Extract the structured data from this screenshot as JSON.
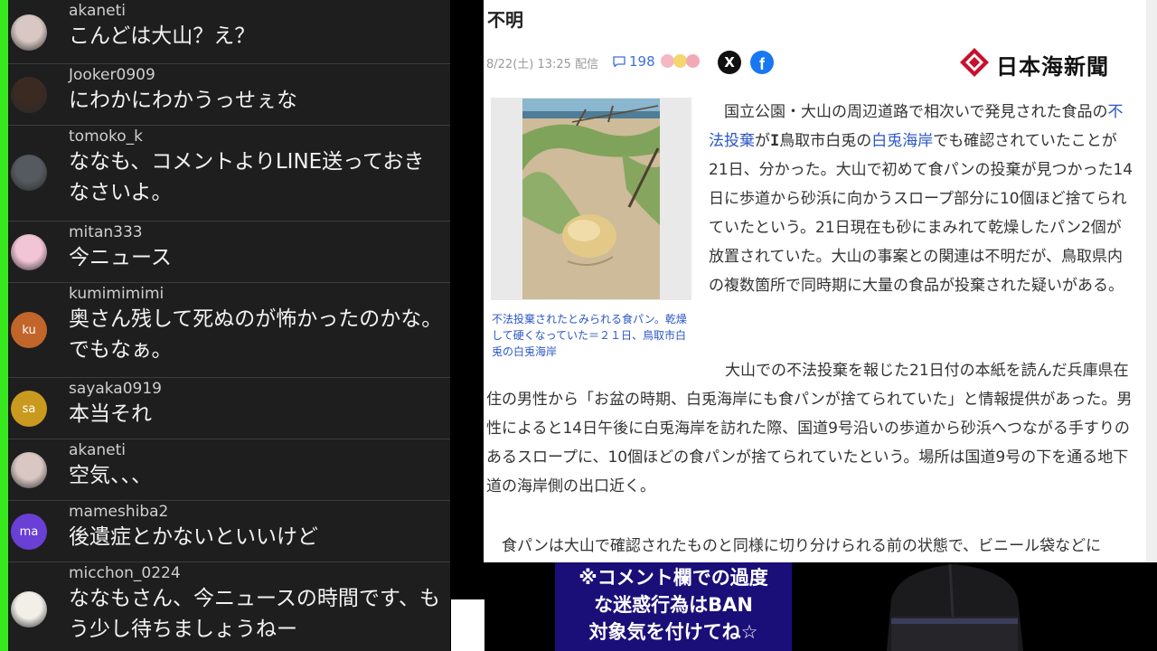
{
  "chat": {
    "messages": [
      {
        "user": "akaneti",
        "text": "こんどは大山？え？",
        "avatar": {
          "type": "photo",
          "color": "#d8c7c2"
        }
      },
      {
        "user": "Jooker0909",
        "text": "にわかにわかうっせぇな",
        "avatar": {
          "type": "photo",
          "color": "#3a2a22"
        }
      },
      {
        "user": "tomoko_k",
        "text": "ななも、コメントよりLINE送っておきなさいよ。",
        "avatar": {
          "type": "photo",
          "color": "#555a60"
        }
      },
      {
        "user": "mitan333",
        "text": "今ニュース",
        "avatar": {
          "type": "photo",
          "color": "#f2c5d6"
        }
      },
      {
        "user": "kumimimimi",
        "text": "奥さん残して死ぬのが怖かったのかな。でもなぁ。",
        "avatar": {
          "type": "initials",
          "initials": "ku",
          "color": "#c2652a"
        }
      },
      {
        "user": "sayaka0919",
        "text": "本当それ",
        "avatar": {
          "type": "initials",
          "initials": "sa",
          "color": "#c99a1e"
        }
      },
      {
        "user": "akaneti",
        "text": "空気、、、",
        "avatar": {
          "type": "photo",
          "color": "#d8c7c2"
        }
      },
      {
        "user": "mameshiba2",
        "text": "後遺症とかないといいけど",
        "avatar": {
          "type": "initials",
          "initials": "ma",
          "color": "#6a3fd6"
        }
      },
      {
        "user": "micchon_0224",
        "text": "ななもさん、今ニュースの時間です、もう少し待ちましょうねー",
        "avatar": {
          "type": "photo",
          "color": "#f1efe8"
        }
      }
    ]
  },
  "article": {
    "title": "不明",
    "meta": "8/22(土) 13:25 配信",
    "comment_count": "198",
    "share": {
      "x_label": "X",
      "facebook_label": "f"
    },
    "publisher": "日本海新聞",
    "photo_caption": "不法投棄されたとみられる食パン。乾燥して硬くなっていた＝２１日、鳥取市白兎の白兎海岸",
    "p1": {
      "t1": "国立公園・大山の周辺道路で相次いで発見された食品の",
      "link1": "不法投棄",
      "t2": "が",
      "t3": "鳥取市白兎の",
      "link2": "白兎海岸",
      "t4": "でも確認されていたことが21日、分かった。大山で初めて食パンの投棄が見つかった14日に歩道から砂浜に向かうスロープ部分に10個ほど捨てられていたという。21日現在も砂にまみれて乾燥したパン2個が放置されていた。大山の事案との関連は不明だが、鳥取県内の複数箇所で同時期に大量の食品が投棄された疑いがある。"
    },
    "p2": "大山での不法投棄を報じた21日付の本紙を読んだ兵庫県在住の男性から「お盆の時期、白兎海岸にも食パンが捨てられていた」と情報提供があった。男性によると14日午後に白兎海岸を訪れた際、国道9号沿いの歩道から砂浜へつながる手すりのあるスロープに、10個ほどの食パンが捨てられていたという。場所は国道9号の下を通る地下道の海岸側の出口近く。",
    "p3": "食パンは大山で確認されたものと同様に切り分けられる前の状態で、ビニール袋などに"
  },
  "overlay": {
    "notice": "※コメント欄での過度\nな迷惑行為はBAN\n対象気を付けてね☆"
  },
  "colors": {
    "chat_bg": "#1e1e1e",
    "chat_accent": "#38e81e",
    "link": "#2a56c6",
    "notice_bg": "#1a0f78"
  }
}
